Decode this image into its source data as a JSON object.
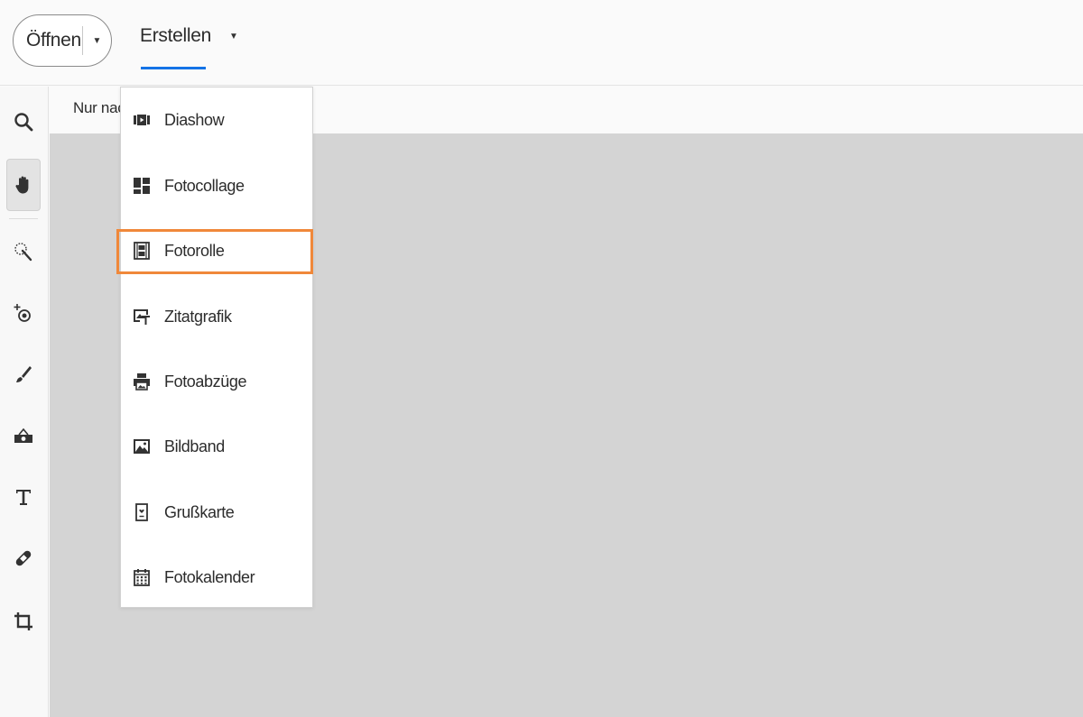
{
  "header": {
    "open_label": "Öffnen",
    "create_label": "Erstellen"
  },
  "subbar": {
    "text": "Nur nach"
  },
  "toolbar": {
    "tools": [
      {
        "name": "zoom-tool",
        "icon": "magnifier-icon"
      },
      {
        "name": "hand-tool",
        "icon": "hand-icon",
        "active": true
      },
      {
        "name": "quick-selection-tool",
        "icon": "magic-wand-icon"
      },
      {
        "name": "red-eye-tool",
        "icon": "eye-plus-icon"
      },
      {
        "name": "whiten-teeth-tool",
        "icon": "brush-icon"
      },
      {
        "name": "straighten-tool",
        "icon": "level-icon"
      },
      {
        "name": "text-tool",
        "icon": "text-t-icon"
      },
      {
        "name": "healing-tool",
        "icon": "bandage-icon"
      },
      {
        "name": "crop-tool",
        "icon": "crop-icon"
      }
    ]
  },
  "menu": {
    "items": [
      {
        "label": "Diashow",
        "icon": "slideshow-icon"
      },
      {
        "label": "Fotocollage",
        "icon": "collage-icon"
      },
      {
        "label": "Fotorolle",
        "icon": "filmstrip-icon"
      },
      {
        "label": "Zitatgrafik",
        "icon": "quote-graphic-icon"
      },
      {
        "label": "Fotoabzüge",
        "icon": "printer-icon"
      },
      {
        "label": "Bildband",
        "icon": "photo-book-icon"
      },
      {
        "label": "Grußkarte",
        "icon": "greeting-card-icon"
      },
      {
        "label": "Fotokalender",
        "icon": "calendar-icon"
      }
    ],
    "highlighted_item": "Fotorolle"
  },
  "colors": {
    "accent_underline": "#1473e6",
    "highlight_border": "#f0883a",
    "canvas_bg": "#d4d4d4"
  }
}
